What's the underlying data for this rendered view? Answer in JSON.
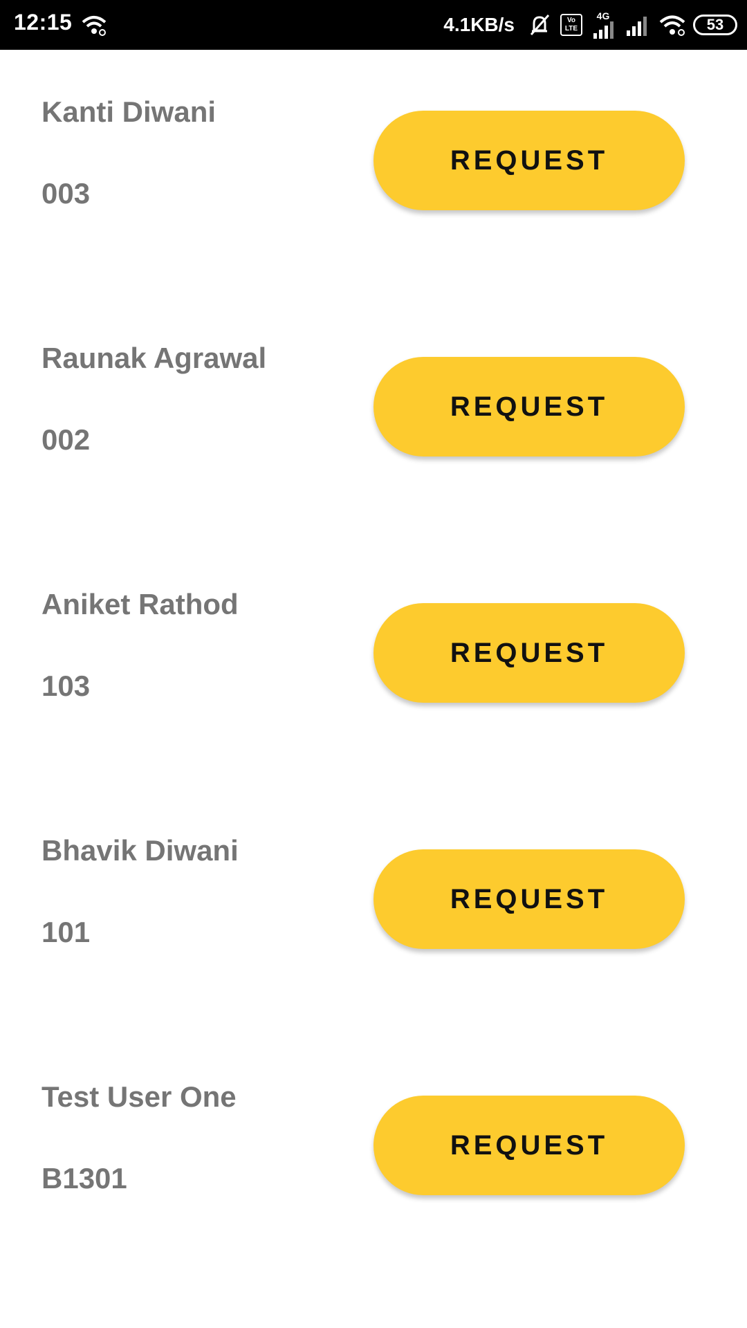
{
  "status_bar": {
    "time": "12:15",
    "net_speed": "4.1KB/s",
    "volte_label": "Vo LTE",
    "network_type": "4G",
    "battery": "53"
  },
  "users": [
    {
      "name": "Kanti Diwani",
      "code": "003",
      "button_label": "REQUEST"
    },
    {
      "name": "Raunak Agrawal",
      "code": "002",
      "button_label": "REQUEST"
    },
    {
      "name": "Aniket Rathod",
      "code": "103",
      "button_label": "REQUEST"
    },
    {
      "name": "Bhavik Diwani",
      "code": "101",
      "button_label": "REQUEST"
    },
    {
      "name": "Test User One",
      "code": "B1301",
      "button_label": "REQUEST"
    }
  ],
  "colors": {
    "button_bg": "#FDCB2E",
    "text_gray": "#757575",
    "status_bar_bg": "#000000"
  }
}
